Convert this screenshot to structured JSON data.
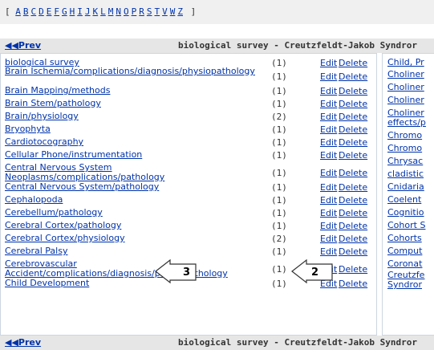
{
  "alphabet": {
    "open": "[",
    "close": "]",
    "letters": [
      "A",
      "B",
      "C",
      "D",
      "E",
      "F",
      "G",
      "H",
      "I",
      "J",
      "K",
      "L",
      "M",
      "N",
      "O",
      "P",
      "R",
      "S",
      "T",
      "V",
      "W",
      "Z"
    ]
  },
  "nav": {
    "prev_label": "Prev",
    "title": "biological survey - Creutzfeldt-Jakob Syndror"
  },
  "rows": [
    {
      "term": "biological survey",
      "count": "(1)"
    },
    {
      "term": "Brain Ischemia/complications/diagnosis/physiopathology",
      "count": "(1)"
    },
    {
      "term": "Brain Mapping/methods",
      "count": "(1)"
    },
    {
      "term": "Brain Stem/pathology",
      "count": "(1)"
    },
    {
      "term": "Brain/physiology",
      "count": "(2)"
    },
    {
      "term": "Bryophyta",
      "count": "(1)"
    },
    {
      "term": "Cardiotocography",
      "count": "(1)"
    },
    {
      "term": "Cellular Phone/instrumentation",
      "count": "(1)"
    },
    {
      "term": "Central Nervous System Neoplasms/complications/pathology",
      "count": "(1)"
    },
    {
      "term": "Central Nervous System/pathology",
      "count": "(1)"
    },
    {
      "term": "Cephalopoda",
      "count": "(1)"
    },
    {
      "term": "Cerebellum/pathology",
      "count": "(1)"
    },
    {
      "term": "Cerebral Cortex/pathology",
      "count": "(1)"
    },
    {
      "term": "Cerebral Cortex/physiology",
      "count": "(2)"
    },
    {
      "term": "Cerebral Palsy",
      "count": "(1)"
    },
    {
      "term": "Cerebrovascular Accident/complications/diagnosis/physiopathology",
      "count": "(1)"
    },
    {
      "term": "Child Development",
      "count": "(1)"
    }
  ],
  "actions": {
    "edit": "Edit",
    "delete": "Delete"
  },
  "right_rows": [
    "Child, Pr",
    "Choliner",
    "Choliner",
    "Choliner",
    "Choliner effects/p",
    "Chromo",
    "Chromo",
    "Chrysac",
    "cladistic",
    "Cnidaria",
    "Coelent",
    "Cognitio",
    "Cohort S",
    "Cohorts",
    "Comput",
    "Coronat",
    "Creutzfe Syndror"
  ],
  "callouts": [
    {
      "label": "3"
    },
    {
      "label": "2"
    }
  ],
  "colors": {
    "link": "#0033aa",
    "navbar": "#e6e6e6",
    "border": "#cdd5e0"
  }
}
